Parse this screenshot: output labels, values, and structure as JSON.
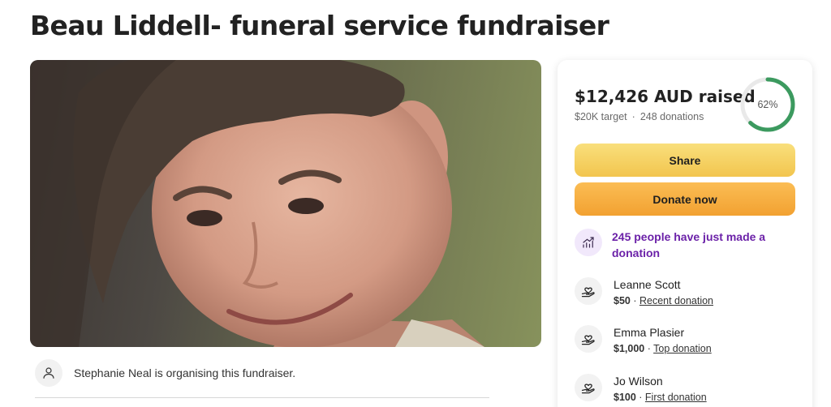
{
  "page": {
    "title": "Beau Liddell- funeral service fundraiser"
  },
  "organiser": {
    "text": "Stephanie Neal is organising this fundraiser.",
    "icon": "user-icon"
  },
  "summary": {
    "raised": "$12,426 AUD raised",
    "target": "$20K target",
    "separator": "·",
    "donations": "248 donations",
    "progress_label": "62%",
    "progress_fraction": 0.62,
    "ring_color": "#3c9a5f",
    "ring_track_color": "#e9e9e9"
  },
  "actions": {
    "share_label": "Share",
    "donate_label": "Donate now"
  },
  "trend": {
    "text": "245 people have just made a donation",
    "icon": "trending-up-icon",
    "color": "#6b21a8"
  },
  "donors": [
    {
      "name": "Leanne Scott",
      "amount": "$50",
      "tag": "Recent donation",
      "icon": "heart-hand-icon"
    },
    {
      "name": "Emma Plasier",
      "amount": "$1,000",
      "tag": "Top donation",
      "icon": "heart-hand-icon"
    },
    {
      "name": "Jo Wilson",
      "amount": "$100",
      "tag": "First donation",
      "icon": "heart-hand-icon"
    }
  ],
  "colors": {
    "share_button": "#f5d163",
    "donate_button": "#f6ae3f"
  }
}
